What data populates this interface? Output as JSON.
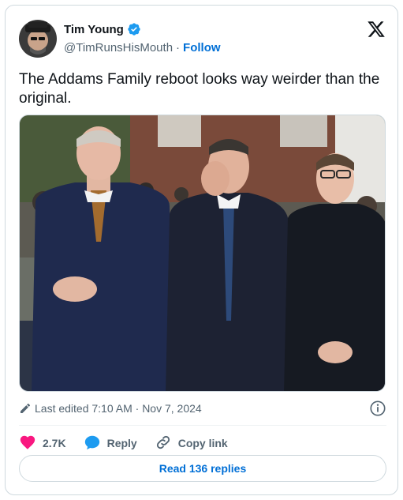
{
  "author": {
    "display_name": "Tim Young",
    "handle": "@TimRunsHisMouth",
    "separator": "·",
    "follow_label": "Follow"
  },
  "tweet": {
    "text": "The Addams Family reboot looks way weirder than the original."
  },
  "meta": {
    "edited": "Last edited 7:10 AM · Nov 7, 2024"
  },
  "actions": {
    "likes": "2.7K",
    "reply_label": "Reply",
    "copy_label": "Copy link"
  },
  "read_replies_label": "Read 136 replies",
  "colors": {
    "link": "#006fd6",
    "heart": "#f91880",
    "verified": "#1d9bf0",
    "reply_bubble": "#1d9bf0"
  },
  "icons": [
    "verified-badge-icon",
    "x-logo-icon",
    "pencil-icon",
    "info-icon",
    "heart-icon",
    "reply-icon",
    "link-icon"
  ]
}
